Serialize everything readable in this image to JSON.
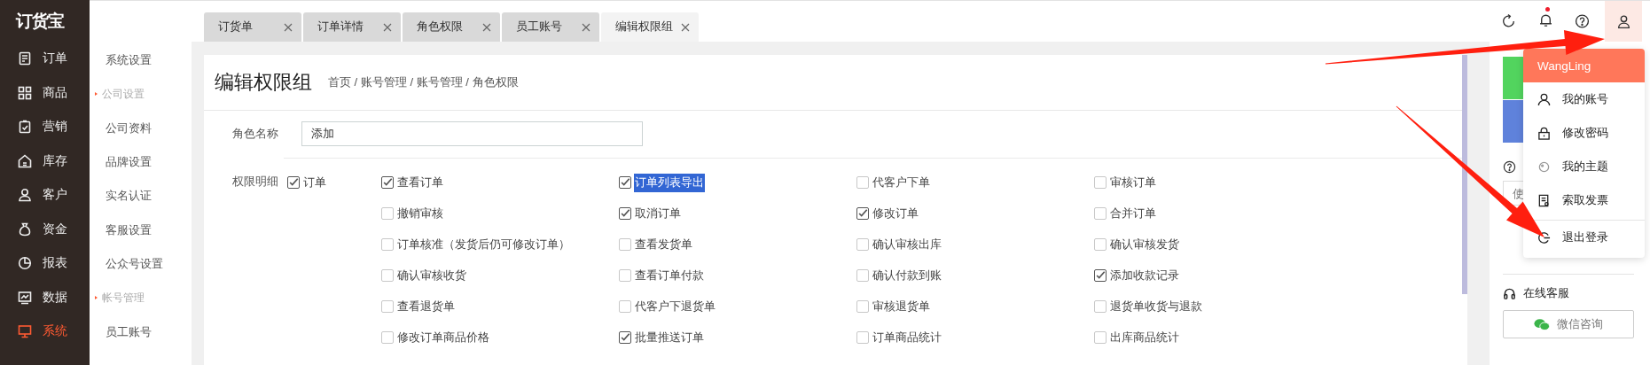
{
  "app": {
    "logo": "订货宝"
  },
  "nav": [
    {
      "label": "订单",
      "selected": false
    },
    {
      "label": "商品",
      "selected": false
    },
    {
      "label": "营销",
      "selected": false
    },
    {
      "label": "库存",
      "selected": false
    },
    {
      "label": "客户",
      "selected": false
    },
    {
      "label": "资金",
      "selected": false
    },
    {
      "label": "报表",
      "selected": false
    },
    {
      "label": "数据",
      "selected": false
    },
    {
      "label": "系统",
      "selected": true
    }
  ],
  "submenu": [
    {
      "kind": "item",
      "label": "系统设置"
    },
    {
      "kind": "group",
      "label": "公司设置"
    },
    {
      "kind": "item",
      "label": "公司资料"
    },
    {
      "kind": "item",
      "label": "品牌设置"
    },
    {
      "kind": "item",
      "label": "实名认证"
    },
    {
      "kind": "item",
      "label": "客服设置"
    },
    {
      "kind": "item",
      "label": "公众号设置"
    },
    {
      "kind": "group",
      "label": "帐号管理"
    },
    {
      "kind": "item",
      "label": "员工账号"
    }
  ],
  "tabs": [
    {
      "label": "订货单",
      "selected": false
    },
    {
      "label": "订单详情",
      "selected": false
    },
    {
      "label": "角色权限",
      "selected": false
    },
    {
      "label": "员工账号",
      "selected": false
    },
    {
      "label": "编辑权限组",
      "selected": true
    }
  ],
  "topbar": {
    "notification_dot": true
  },
  "page": {
    "title": "编辑权限组",
    "breadcrumb": "首页 / 账号管理 / 账号管理 / 角色权限"
  },
  "form": {
    "role_name_label": "角色名称",
    "role_name": "添加",
    "permissions_label": "权限明细",
    "permissions": [
      {
        "label": "订单",
        "checked": true,
        "items": [
          {
            "label": "查看订单",
            "checked": true,
            "highlighted": false
          },
          {
            "label": "订单列表导出",
            "checked": true,
            "highlighted": true
          },
          {
            "label": "代客户下单",
            "checked": false,
            "highlighted": false
          },
          {
            "label": "审核订单",
            "checked": false,
            "highlighted": false
          },
          {
            "label": "撤销审核",
            "checked": false,
            "highlighted": false
          },
          {
            "label": "取消订单",
            "checked": true,
            "highlighted": false
          },
          {
            "label": "修改订单",
            "checked": true,
            "highlighted": false
          },
          {
            "label": "合并订单",
            "checked": false,
            "highlighted": false
          },
          {
            "label": "订单核准（发货后仍可修改订单）",
            "checked": false,
            "highlighted": false
          },
          {
            "label": "查看发货单",
            "checked": false,
            "highlighted": false
          },
          {
            "label": "确认审核出库",
            "checked": false,
            "highlighted": false
          },
          {
            "label": "确认审核发货",
            "checked": false,
            "highlighted": false
          },
          {
            "label": "确认审核收货",
            "checked": false,
            "highlighted": false
          },
          {
            "label": "查看订单付款",
            "checked": false,
            "highlighted": false
          },
          {
            "label": "确认付款到账",
            "checked": false,
            "highlighted": false
          },
          {
            "label": "添加收款记录",
            "checked": true,
            "highlighted": false
          },
          {
            "label": "查看退货单",
            "checked": false,
            "highlighted": false
          },
          {
            "label": "代客户下退货单",
            "checked": false,
            "highlighted": false
          },
          {
            "label": "审核退货单",
            "checked": false,
            "highlighted": false
          },
          {
            "label": "退货单收货与退款",
            "checked": false,
            "highlighted": false
          },
          {
            "label": "修改订单商品价格",
            "checked": false,
            "highlighted": false
          },
          {
            "label": "批量推送订单",
            "checked": true,
            "highlighted": false
          },
          {
            "label": "订单商品统计",
            "checked": false,
            "highlighted": false
          },
          {
            "label": "出库商品统计",
            "checked": false,
            "highlighted": false
          }
        ]
      }
    ]
  },
  "user_menu": {
    "username": "WangLing",
    "items": [
      {
        "kind": "account",
        "label": "我的账号"
      },
      {
        "kind": "password",
        "label": "修改密码"
      },
      {
        "kind": "theme",
        "label": "我的主题"
      },
      {
        "kind": "invoice",
        "label": "索取发票"
      },
      {
        "kind": "logout",
        "label": "退出登录"
      }
    ]
  },
  "side_panel": {
    "field_placeholder": "使",
    "service_title": "在线客服",
    "wechat_button": "微信咨询"
  }
}
